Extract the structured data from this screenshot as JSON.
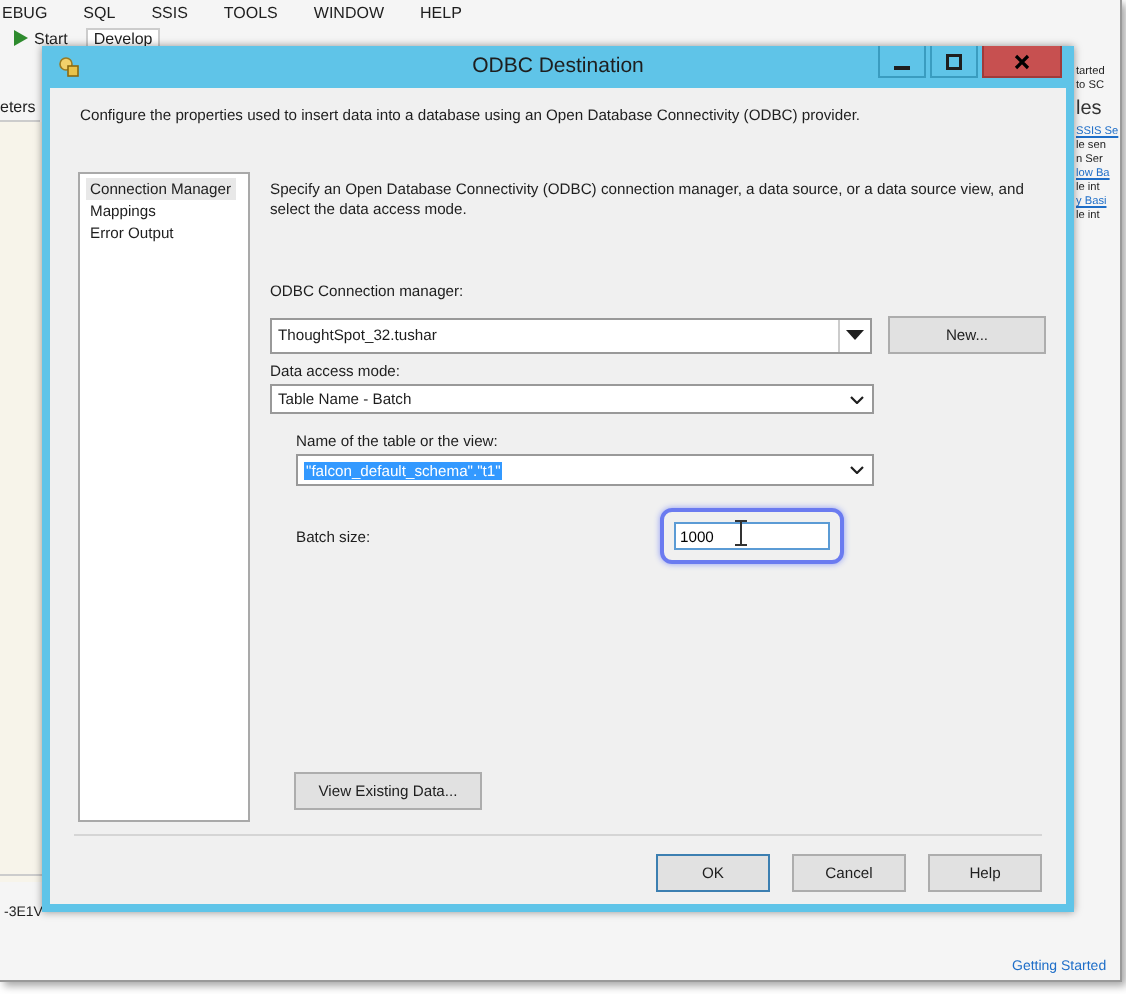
{
  "ide": {
    "menu": [
      "EBUG",
      "SQL",
      "SSIS",
      "TOOLS",
      "WINDOW",
      "HELP"
    ],
    "toolbar": [
      {
        "label": "Start",
        "kind": "run"
      },
      {
        "label": "Develop",
        "kind": "dropdown"
      }
    ],
    "left_tab": "eters",
    "right_fragments": [
      {
        "text": "tarted",
        "kind": "plain"
      },
      {
        "text": "to SC",
        "kind": "plain"
      },
      {
        "text": "les",
        "kind": "heading"
      },
      {
        "text": "SSIS Se",
        "kind": "link"
      },
      {
        "text": "le sen",
        "kind": "plain"
      },
      {
        "text": "n Ser",
        "kind": "plain"
      },
      {
        "text": "low Ba",
        "kind": "link"
      },
      {
        "text": "le int",
        "kind": "plain"
      },
      {
        "text": "y Basi",
        "kind": "link"
      },
      {
        "text": "le int",
        "kind": "plain"
      }
    ],
    "bottom_left": "-3E1V",
    "bottom_right_link": "Getting Started"
  },
  "dialog": {
    "title": "ODBC Destination",
    "description": "Configure the properties used to insert data into a database using an Open Database Connectivity (ODBC) provider.",
    "nav": [
      {
        "label": "Connection Manager",
        "selected": true
      },
      {
        "label": "Mappings",
        "selected": false
      },
      {
        "label": "Error Output",
        "selected": false
      }
    ],
    "intro": "Specify an Open Database Connectivity (ODBC) connection manager, a data source, or a data source view, and select the data access mode.",
    "connection_label": "ODBC Connection manager:",
    "connection_value": "ThoughtSpot_32.tushar",
    "new_button": "New...",
    "access_label": "Data access mode:",
    "access_value": "Table Name - Batch",
    "table_label": "Name of the table or the view:",
    "table_value": "\"falcon_default_schema\".\"t1\"",
    "table_value_selected": true,
    "batch_label": "Batch size:",
    "batch_value": "1000",
    "batch_focused": true,
    "view_button": "View Existing Data...",
    "buttons": [
      {
        "label": "OK",
        "default": true
      },
      {
        "label": "Cancel",
        "default": false
      },
      {
        "label": "Help",
        "default": false
      }
    ]
  }
}
